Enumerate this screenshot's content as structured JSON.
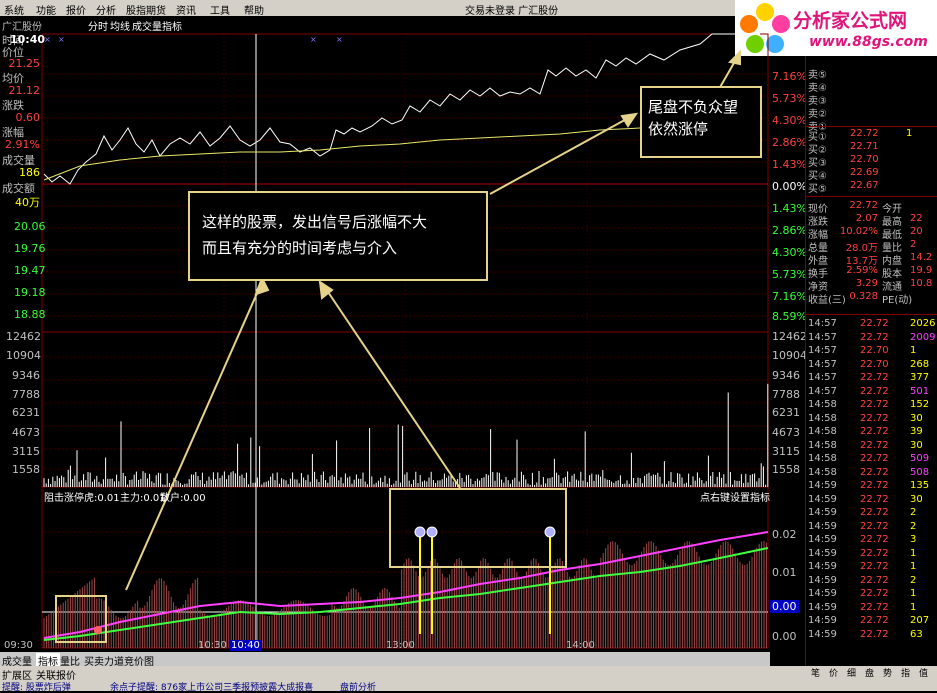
{
  "menu": [
    "系统",
    "功能",
    "报价",
    "分析",
    "股指期货",
    "资讯",
    "工具",
    "帮助"
  ],
  "window_title": "交易未登录  广汇股份",
  "toolbar": {
    "stock": "广汇股份",
    "items": [
      "分时",
      "均线",
      "成交量",
      "指标"
    ]
  },
  "logo": {
    "brand": "分析家公式网",
    "url": "www.88gs.com"
  },
  "left_panel": {
    "time_label": "时间",
    "time": "10:40",
    "price_label": "价位",
    "price": "21.25",
    "avg_label": "均价",
    "avg": "21.12",
    "change_label": "涨跌",
    "change": "0.60",
    "pct_label": "涨幅",
    "pct": "2.91%",
    "vol_label": "成交量",
    "vol": "186",
    "amount_label": "成交额",
    "amount": "40万"
  },
  "price_axis_left": [
    "20.06",
    "19.76",
    "19.47",
    "19.18",
    "18.88"
  ],
  "vol_axis_left": [
    "12462",
    "10904",
    "9346",
    "7788",
    "6231",
    "4673",
    "3115",
    "1558"
  ],
  "pct_axis_right": [
    "7.16%",
    "5.73%",
    "4.30%",
    "2.86%",
    "1.43%",
    "0.00%",
    "1.43%",
    "2.86%",
    "4.30%",
    "5.73%",
    "7.16%",
    "8.59%"
  ],
  "vol_axis_right": [
    "12462",
    "10904",
    "9346",
    "7788",
    "6231",
    "4673",
    "3115",
    "1558"
  ],
  "indicator_header": {
    "name": "阻击涨停",
    "tiger_label": "虎:0.01",
    "main_label": "主力:0.01",
    "retail_label": "散户:0.00",
    "setting": "点右键设置指标"
  },
  "indicator_axis_right": [
    "0.02",
    "0.01",
    "0.00",
    "0.00"
  ],
  "time_axis": [
    "09:30",
    "10:30",
    "10:40",
    "13:00",
    "14:00"
  ],
  "callouts": {
    "main": [
      "这样的股票，发出信号后涨幅不大",
      "而且有充分的时间考虑与介入"
    ],
    "tail": [
      "尾盘不负众望",
      "依然涨停"
    ]
  },
  "bottom_tabs": [
    "成交量",
    "指标",
    "量比",
    "买卖力道",
    "竞价图"
  ],
  "bottom_tabs2": [
    "扩展区",
    "关联报价"
  ],
  "statusbar": [
    "提醒: 股票炸后弹",
    "余点子提醒: 876家上市公司三季报预披露大成报喜",
    "盘前分析"
  ],
  "order_book": {
    "sell": [
      {
        "label": "卖⑤",
        "price": "",
        "vol": ""
      },
      {
        "label": "卖④",
        "price": "",
        "vol": ""
      },
      {
        "label": "卖③",
        "price": "",
        "vol": ""
      },
      {
        "label": "卖②",
        "price": "",
        "vol": ""
      },
      {
        "label": "卖①",
        "price": "",
        "vol": ""
      }
    ],
    "buy": [
      {
        "label": "买①",
        "price": "22.72",
        "vol": "1"
      },
      {
        "label": "买②",
        "price": "22.71",
        "vol": ""
      },
      {
        "label": "买③",
        "price": "22.70",
        "vol": ""
      },
      {
        "label": "买④",
        "price": "22.69",
        "vol": ""
      },
      {
        "label": "买⑤",
        "price": "22.67",
        "vol": ""
      }
    ]
  },
  "quote_info": [
    {
      "label": "现价",
      "value": "22.72",
      "label2": "今开",
      "value2": ""
    },
    {
      "label": "涨跌",
      "value": "2.07",
      "label2": "最高",
      "value2": "22"
    },
    {
      "label": "涨幅",
      "value": "10.02%",
      "label2": "最低",
      "value2": "20"
    },
    {
      "label": "总量",
      "value": "28.0万",
      "label2": "量比",
      "value2": "2"
    },
    {
      "label": "外盘",
      "value": "13.7万",
      "label2": "内盘",
      "value2": "14.2"
    },
    {
      "label": "换手",
      "value": "2.59%",
      "label2": "股本",
      "value2": "19.9"
    },
    {
      "label": "净资",
      "value": "3.29",
      "label2": "流通",
      "value2": "10.8"
    },
    {
      "label": "收益(三)",
      "value": "0.328",
      "label2": "PE(动)",
      "value2": ""
    }
  ],
  "ticks": [
    {
      "t": "14:57",
      "p": "22.72",
      "v": "2026"
    },
    {
      "t": "14:57",
      "p": "22.72",
      "v": "2009"
    },
    {
      "t": "14:57",
      "p": "22.70",
      "v": "1"
    },
    {
      "t": "14:57",
      "p": "22.70",
      "v": "268"
    },
    {
      "t": "14:57",
      "p": "22.72",
      "v": "377"
    },
    {
      "t": "14:57",
      "p": "22.72",
      "v": "501"
    },
    {
      "t": "14:58",
      "p": "22.72",
      "v": "152"
    },
    {
      "t": "14:58",
      "p": "22.72",
      "v": "30"
    },
    {
      "t": "14:58",
      "p": "22.72",
      "v": "39"
    },
    {
      "t": "14:58",
      "p": "22.72",
      "v": "30"
    },
    {
      "t": "14:58",
      "p": "22.72",
      "v": "509"
    },
    {
      "t": "14:58",
      "p": "22.72",
      "v": "508"
    },
    {
      "t": "14:59",
      "p": "22.72",
      "v": "135"
    },
    {
      "t": "14:59",
      "p": "22.72",
      "v": "30"
    },
    {
      "t": "14:59",
      "p": "22.72",
      "v": "2"
    },
    {
      "t": "14:59",
      "p": "22.72",
      "v": "2"
    },
    {
      "t": "14:59",
      "p": "22.72",
      "v": "3"
    },
    {
      "t": "14:59",
      "p": "22.72",
      "v": "1"
    },
    {
      "t": "14:59",
      "p": "22.72",
      "v": "1"
    },
    {
      "t": "14:59",
      "p": "22.72",
      "v": "2"
    },
    {
      "t": "14:59",
      "p": "22.72",
      "v": "1"
    },
    {
      "t": "14:59",
      "p": "22.72",
      "v": "1"
    },
    {
      "t": "14:59",
      "p": "22.72",
      "v": "207"
    },
    {
      "t": "14:59",
      "p": "22.72",
      "v": "63"
    }
  ],
  "right_tabs": [
    "笔",
    "价",
    "细",
    "盘",
    "势",
    "指",
    "值"
  ],
  "colors": {
    "up": "#ff4040",
    "down": "#33ff33",
    "label": "#ffff00",
    "callout_border": "#e6d38a",
    "grid": "#600000"
  }
}
